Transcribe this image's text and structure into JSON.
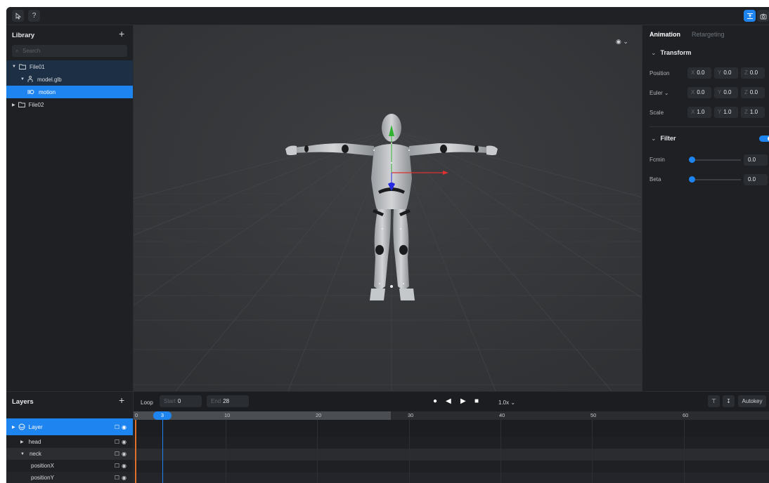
{
  "toolbar": {
    "left_icons": [
      "pointer-icon",
      "help-icon"
    ],
    "help_label": "?",
    "right_icons": [
      "align-icon",
      "camera-icon"
    ]
  },
  "library": {
    "title": "Library",
    "add_label": "+",
    "search_placeholder": "Search",
    "tree": [
      {
        "label": "File01",
        "icon": "folder-icon",
        "expanded": true,
        "level": 0
      },
      {
        "label": "model.glb",
        "icon": "person-icon",
        "expanded": true,
        "level": 1
      },
      {
        "label": "motion",
        "icon": "motion-icon",
        "selected": true,
        "level": 2
      },
      {
        "label": "File02",
        "icon": "folder-icon",
        "expanded": false,
        "level": 0
      }
    ]
  },
  "viewport": {
    "view_menu_icon": "eye-icon"
  },
  "inspector": {
    "tabs": [
      "Animation",
      "Retargeting"
    ],
    "active_tab": "Animation",
    "transform": {
      "title": "Transform",
      "rows": [
        {
          "label": "Position",
          "x": "0.0",
          "y": "0.0",
          "z": "0.0"
        },
        {
          "label": "Euler",
          "x": "0.0",
          "y": "0.0",
          "z": "0.0"
        },
        {
          "label": "Scale",
          "x": "1.0",
          "y": "1.0",
          "z": "1.0"
        }
      ]
    },
    "filter": {
      "title": "Filter",
      "enabled": true,
      "rows": [
        {
          "label": "Fcmin",
          "value": "0.0"
        },
        {
          "label": "Beta",
          "value": "0.0"
        }
      ]
    },
    "axis_labels": [
      "X",
      "Y",
      "Z"
    ]
  },
  "layers": {
    "title": "Layers",
    "add_label": "+",
    "rows": [
      {
        "label": "Layer",
        "selected": true,
        "expanded": false
      },
      {
        "label": "head",
        "expanded": false
      },
      {
        "label": "neck",
        "expanded": true
      },
      {
        "label": "positionX"
      },
      {
        "label": "positionY"
      }
    ]
  },
  "timeline": {
    "loop_label": "Loop",
    "start_label": "Start",
    "start_value": "0",
    "end_label": "End",
    "end_value": "28",
    "speed": "1.0x",
    "autokey_label": "Autokey",
    "current_frame": "3",
    "ruler_labels": [
      "0",
      "10",
      "20",
      "30",
      "40",
      "50",
      "60"
    ]
  }
}
